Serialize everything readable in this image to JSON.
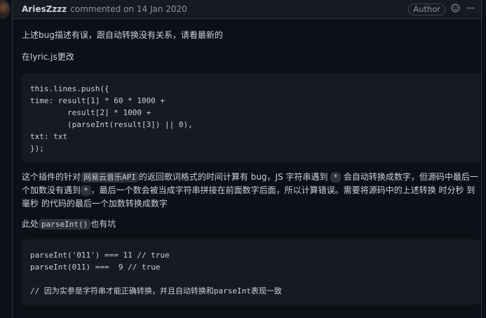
{
  "header": {
    "author": "AriesZzzz",
    "commented": "commented on 14 Jan 2020",
    "badge": "Author",
    "reaction_icon": "smiley-icon",
    "menu_icon": "kebab-horizontal-icon"
  },
  "body": {
    "p1": "上述bug描述有误，跟自动转换没有关系，请看最新的",
    "p2": "在lyric.js更改",
    "code1": "this.lines.push({\ntime: result[1] * 60 * 1000 +\n        result[2] * 1000 +\n        (parseInt(result[3]) || 0),\ntxt: txt\n});",
    "p3": {
      "t1": "这个插件的针对",
      "c1": "网易云音乐API",
      "t2": "的返回歌词格式的时间计算有 bug，JS 字符串遇到",
      "c2": "*",
      "t3": "会自动转换成数字，但源码中最后一个加数没有遇到",
      "c3": "*",
      "t4": "，最后一个数会被当成字符串拼接在前面数字后面，所以计算错误。需要将源码中的上述转换 时分秒 到 毫秒 的代码的最后一个加数转换成数字"
    },
    "p4": {
      "t1": "此处",
      "c1": "parseInt()",
      "t2": "也有坑"
    },
    "code2": "parseInt('011') === 11 // true\nparseInt(011) ===  9 // true\n\n// 因为实参是字符串才能正确转换，并且自动转换和parseInt表现一致"
  }
}
